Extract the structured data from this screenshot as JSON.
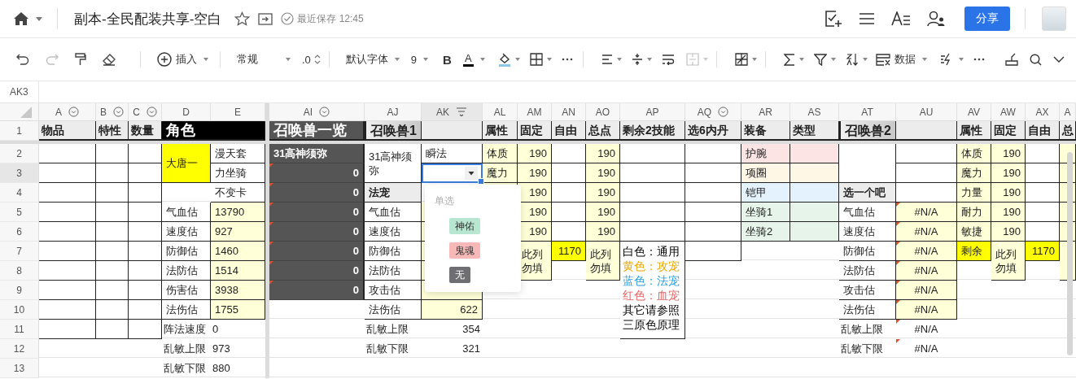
{
  "document": {
    "title": "副本-全民配装共享-空白",
    "save_status": "最近保存 12:45"
  },
  "share_button": "分享",
  "toolbar": {
    "insert": "插入",
    "number_format": "常规",
    "decimal": ".0",
    "font": "默认字体",
    "font_size": "9",
    "bold": "B",
    "font_color": "A",
    "data": "数据",
    "redo_disabled": true,
    "merge_disabled": true
  },
  "name_box": "AK3",
  "columns": [
    {
      "letter": "A",
      "filter": true,
      "selected": false
    },
    {
      "letter": "B",
      "filter": true,
      "selected": false
    },
    {
      "letter": "C",
      "filter": true,
      "selected": false
    },
    {
      "letter": "D",
      "filter": false,
      "selected": false
    },
    {
      "letter": "E",
      "filter": false,
      "selected": false
    },
    {
      "letter": "AI",
      "filter": true,
      "selected": false
    },
    {
      "letter": "AJ",
      "filter": false,
      "selected": false
    },
    {
      "letter": "AK",
      "filter": false,
      "selected": true
    },
    {
      "letter": "AL",
      "filter": false,
      "selected": false
    },
    {
      "letter": "AM",
      "filter": false,
      "selected": false
    },
    {
      "letter": "AN",
      "filter": false,
      "selected": false
    },
    {
      "letter": "AO",
      "filter": false,
      "selected": false
    },
    {
      "letter": "AP",
      "filter": false,
      "selected": false
    },
    {
      "letter": "AQ",
      "filter": true,
      "selected": false
    },
    {
      "letter": "AR",
      "filter": false,
      "selected": false
    },
    {
      "letter": "AS",
      "filter": false,
      "selected": false
    },
    {
      "letter": "AT",
      "filter": false,
      "selected": false
    },
    {
      "letter": "AU",
      "filter": false,
      "selected": false
    },
    {
      "letter": "AV",
      "filter": false,
      "selected": false
    },
    {
      "letter": "AW",
      "filter": false,
      "selected": false
    },
    {
      "letter": "AX",
      "filter": false,
      "selected": false
    },
    {
      "letter": "A",
      "filter": false,
      "selected": false
    }
  ],
  "rows": [
    {
      "number": "1",
      "selected": false,
      "cells": [
        {
          "text": "物品",
          "kind": "head"
        },
        {
          "text": "特性",
          "kind": "head"
        },
        {
          "text": "数量",
          "kind": "head"
        },
        {
          "text": "角色",
          "kind": "black"
        },
        {
          "kind": "merged-left"
        },
        {
          "text": "召唤兽一览",
          "kind": "dark-title"
        },
        {
          "text": "召唤兽1",
          "kind": "title"
        },
        {
          "kind": "head"
        },
        {
          "text": "属性",
          "kind": "head"
        },
        {
          "text": "固定",
          "kind": "head"
        },
        {
          "text": "自由",
          "kind": "head"
        },
        {
          "text": "总点",
          "kind": "head"
        },
        {
          "text": "剩余2技能",
          "kind": "head"
        },
        {
          "text": "选6内丹",
          "kind": "head"
        },
        {
          "text": "装备",
          "kind": "head"
        },
        {
          "text": "类型",
          "kind": "head"
        },
        {
          "text": "召唤兽2",
          "kind": "title"
        },
        {
          "kind": "head"
        },
        {
          "text": "属性",
          "kind": "head"
        },
        {
          "text": "固定",
          "kind": "head"
        },
        {
          "text": "自由",
          "kind": "head"
        },
        {
          "text": "总",
          "kind": "head"
        }
      ]
    },
    {
      "number": "2",
      "selected": false,
      "cells": [
        {
          "kind": "box"
        },
        {
          "kind": "box"
        },
        {
          "kind": "box"
        },
        {
          "text": "大唐一",
          "kind": "yellow"
        },
        {
          "text": "漫天套",
          "kind": "box"
        },
        {
          "text": "31高神须弥",
          "kind": "dark"
        },
        {
          "text": "31高神须弥",
          "kind": "box"
        },
        {
          "text": "瞬法",
          "kind": "box"
        },
        {
          "text": "体质",
          "kind": "pale"
        },
        {
          "text": "190",
          "kind": "pale"
        },
        {
          "kind": "box"
        },
        {
          "text": "190",
          "kind": "pale"
        },
        {
          "kind": "box"
        },
        {
          "kind": "box"
        },
        {
          "text": "护腕",
          "kind": "pink"
        },
        {
          "kind": "pink"
        },
        {
          "kind": "box"
        },
        {
          "kind": "box"
        },
        {
          "text": "体质",
          "kind": "pale"
        },
        {
          "text": "190",
          "kind": "pale"
        },
        {
          "kind": "box"
        },
        {
          "kind": "pale"
        }
      ]
    },
    {
      "number": "3",
      "selected": true,
      "cells": [
        {
          "kind": "box"
        },
        {
          "kind": "box"
        },
        {
          "kind": "box"
        },
        {
          "kind": "merged-up"
        },
        {
          "text": "力坐骑",
          "kind": "box"
        },
        {
          "text": "0",
          "kind": "dark",
          "note": true
        },
        {
          "kind": "merged-up"
        },
        {
          "kind": "dropdown",
          "dropdown": {
            "title": "单选",
            "options": [
              {
                "label": "神佑",
                "color": "#b8e6d0",
                "selected": false
              },
              {
                "label": "鬼魂",
                "color": "#f7b8b8",
                "selected": false
              },
              {
                "label": "无",
                "color": "#6e6e73",
                "selected": false
              }
            ]
          }
        },
        {
          "text": "魔力",
          "kind": "pale"
        },
        {
          "text": "190",
          "kind": "pale"
        },
        {
          "kind": "box"
        },
        {
          "text": "190",
          "kind": "pale"
        },
        {
          "kind": "box"
        },
        {
          "kind": "box"
        },
        {
          "text": "项圈",
          "kind": "cream"
        },
        {
          "kind": "cream"
        },
        {
          "kind": "merged-up"
        },
        {
          "kind": "box"
        },
        {
          "text": "魔力",
          "kind": "pale"
        },
        {
          "text": "190",
          "kind": "pale"
        },
        {
          "kind": "box"
        },
        {
          "kind": "pale"
        }
      ]
    },
    {
      "number": "4",
      "selected": false,
      "cells": [
        {
          "kind": "box"
        },
        {
          "kind": "box"
        },
        {
          "kind": "box"
        },
        {},
        {
          "text": "不变卡",
          "kind": "box"
        },
        {
          "text": "0",
          "kind": "dark",
          "note": true
        },
        {
          "text": "法宠",
          "kind": "section"
        },
        {},
        {
          "kind": "pale"
        },
        {
          "text": "190",
          "kind": "pale"
        },
        {
          "kind": "box"
        },
        {
          "text": "190",
          "kind": "pale"
        },
        {
          "kind": "box"
        },
        {
          "kind": "box"
        },
        {
          "text": "铠甲",
          "kind": "blue"
        },
        {
          "kind": "blue"
        },
        {
          "text": "选一个吧",
          "kind": "section"
        },
        {
          "kind": "box"
        },
        {
          "text": "力量",
          "kind": "pale"
        },
        {
          "text": "190",
          "kind": "pale"
        },
        {
          "kind": "box"
        },
        {
          "kind": "pale"
        }
      ]
    },
    {
      "number": "5",
      "selected": false,
      "cells": [
        {
          "kind": "box"
        },
        {
          "kind": "box"
        },
        {
          "kind": "box"
        },
        {
          "text": "气血估",
          "kind": "box"
        },
        {
          "text": "13790",
          "kind": "pale"
        },
        {
          "text": "0",
          "kind": "dark",
          "note": true
        },
        {
          "text": "气血估",
          "kind": "box"
        },
        {
          "kind": "pale"
        },
        {
          "kind": "pale"
        },
        {
          "text": "190",
          "kind": "pale"
        },
        {
          "kind": "box"
        },
        {
          "text": "190",
          "kind": "pale"
        },
        {
          "kind": "box"
        },
        {
          "kind": "box"
        },
        {
          "text": "坐骑1",
          "kind": "green"
        },
        {
          "kind": "green"
        },
        {
          "text": "气血估",
          "kind": "box"
        },
        {
          "text": "#N/A",
          "kind": "pale",
          "note": true
        },
        {
          "text": "耐力",
          "kind": "pale"
        },
        {
          "text": "190",
          "kind": "pale"
        },
        {
          "kind": "box"
        },
        {
          "kind": "pale"
        }
      ]
    },
    {
      "number": "6",
      "selected": false,
      "cells": [
        {
          "kind": "box"
        },
        {
          "kind": "box"
        },
        {
          "kind": "box"
        },
        {
          "text": "速度估",
          "kind": "box"
        },
        {
          "text": "927",
          "kind": "pale"
        },
        {
          "text": "0",
          "kind": "dark",
          "note": true
        },
        {
          "text": "速度估",
          "kind": "box"
        },
        {
          "kind": "pale"
        },
        {
          "kind": "pale"
        },
        {
          "text": "190",
          "kind": "pale"
        },
        {
          "kind": "box"
        },
        {
          "text": "190",
          "kind": "pale"
        },
        {
          "kind": "box"
        },
        {
          "kind": "box"
        },
        {
          "text": "坐骑2",
          "kind": "green"
        },
        {
          "kind": "green"
        },
        {
          "text": "速度估",
          "kind": "box"
        },
        {
          "text": "#N/A",
          "kind": "pale",
          "note": true
        },
        {
          "text": "敏捷",
          "kind": "pale"
        },
        {
          "text": "190",
          "kind": "pale"
        },
        {
          "kind": "box"
        },
        {
          "kind": "pale"
        }
      ]
    },
    {
      "number": "7",
      "selected": false,
      "cells": [
        {
          "kind": "box"
        },
        {
          "kind": "box"
        },
        {
          "kind": "box"
        },
        {
          "text": "防御估",
          "kind": "box"
        },
        {
          "text": "1460",
          "kind": "pale"
        },
        {
          "text": "0",
          "kind": "dark",
          "note": true
        },
        {
          "text": "防御估",
          "kind": "box"
        },
        {
          "kind": "pale"
        },
        {},
        {
          "text": "此列勿填",
          "kind": "pale"
        },
        {
          "text": "1170",
          "kind": "yellow"
        },
        {
          "text": "此列勿填",
          "kind": "pale"
        },
        {
          "kind": "legend",
          "lines": [
            {
              "text": "白色：通用"
            },
            {
              "text": "黄色：攻宠",
              "color": "#e6a800"
            },
            {
              "text": "蓝色：法宠",
              "color": "#2b9fd8"
            },
            {
              "text": "红色：血宠",
              "color": "#e06666"
            },
            {
              "text": "其它请参照"
            },
            {
              "text": "三原色原理"
            }
          ]
        },
        {
          "kind": "box"
        },
        {},
        {},
        {
          "text": "防御估",
          "kind": "box"
        },
        {
          "text": "#N/A",
          "kind": "pale",
          "note": true
        },
        {
          "text": "剩余",
          "kind": "yellow"
        },
        {
          "text": "此列勿填",
          "kind": "pale"
        },
        {
          "text": "1170",
          "kind": "yellow"
        },
        {
          "kind": "pale"
        }
      ]
    },
    {
      "number": "8",
      "selected": false,
      "cells": [
        {
          "kind": "box"
        },
        {
          "kind": "box"
        },
        {
          "kind": "box"
        },
        {
          "text": "法防估",
          "kind": "box"
        },
        {
          "text": "1514",
          "kind": "pale"
        },
        {
          "text": "0",
          "kind": "dark",
          "note": true
        },
        {
          "text": "法防估",
          "kind": "box"
        },
        {
          "kind": "pale"
        },
        {},
        {
          "kind": "merged-up"
        },
        {},
        {
          "kind": "merged-up"
        },
        {
          "kind": "merged-up"
        },
        {},
        {},
        {},
        {
          "text": "法防估",
          "kind": "box"
        },
        {
          "text": "#N/A",
          "kind": "pale",
          "note": true
        },
        {},
        {
          "kind": "merged-up"
        },
        {},
        {
          "kind": "merged-up"
        }
      ]
    },
    {
      "number": "9",
      "selected": false,
      "cells": [
        {
          "kind": "box"
        },
        {
          "kind": "box"
        },
        {
          "kind": "box"
        },
        {
          "text": "伤害估",
          "kind": "box"
        },
        {
          "text": "3938",
          "kind": "pale"
        },
        {
          "text": "0",
          "kind": "dark",
          "note": true
        },
        {
          "text": "攻击估",
          "kind": "box"
        },
        {
          "kind": "pale"
        },
        {},
        {},
        {},
        {},
        {
          "kind": "merged-up"
        },
        {},
        {},
        {},
        {
          "text": "攻击估",
          "kind": "box"
        },
        {
          "text": "#N/A",
          "kind": "pale",
          "note": true
        }
      ]
    },
    {
      "number": "10",
      "selected": false,
      "cells": [
        {
          "kind": "box"
        },
        {
          "kind": "box"
        },
        {
          "kind": "box"
        },
        {
          "text": "法伤估",
          "kind": "box"
        },
        {
          "text": "1755",
          "kind": "pale"
        },
        {},
        {
          "text": "法伤估",
          "kind": "box"
        },
        {
          "text": "622",
          "kind": "pale"
        },
        {},
        {},
        {},
        {},
        {
          "kind": "merged-up"
        },
        {},
        {},
        {},
        {
          "text": "法伤估",
          "kind": "box"
        },
        {
          "text": "#N/A",
          "kind": "pale",
          "note": true
        }
      ]
    },
    {
      "number": "11",
      "selected": false,
      "cells": [
        {
          "kind": "box"
        },
        {
          "kind": "box"
        },
        {
          "kind": "box"
        },
        {
          "text": "阵法速度",
          "kind": "plain"
        },
        {
          "text": "0",
          "kind": "plain"
        },
        {},
        {
          "text": "乱敏上限",
          "kind": "plain"
        },
        {
          "text": "354",
          "kind": "plain"
        },
        {},
        {},
        {},
        {},
        {
          "kind": "merged-up"
        },
        {},
        {},
        {},
        {
          "text": "乱敏上限",
          "kind": "plain"
        },
        {
          "text": "#N/A",
          "kind": "plain",
          "note": true
        }
      ]
    },
    {
      "number": "12",
      "selected": false,
      "cells": [
        {},
        {},
        {},
        {
          "text": "乱敏上限",
          "kind": "plain"
        },
        {
          "text": "973",
          "kind": "plain"
        },
        {},
        {
          "text": "乱敏下限",
          "kind": "plain"
        },
        {
          "text": "321",
          "kind": "plain"
        },
        {},
        {},
        {},
        {},
        {},
        {},
        {},
        {},
        {
          "text": "乱敏下限",
          "kind": "plain"
        },
        {
          "text": "#N/A",
          "kind": "plain",
          "note": true
        }
      ]
    },
    {
      "number": "13",
      "selected": false,
      "cells": [
        {},
        {},
        {},
        {
          "text": "乱敏下限",
          "kind": "plain"
        },
        {
          "text": "880",
          "kind": "plain"
        }
      ]
    }
  ]
}
